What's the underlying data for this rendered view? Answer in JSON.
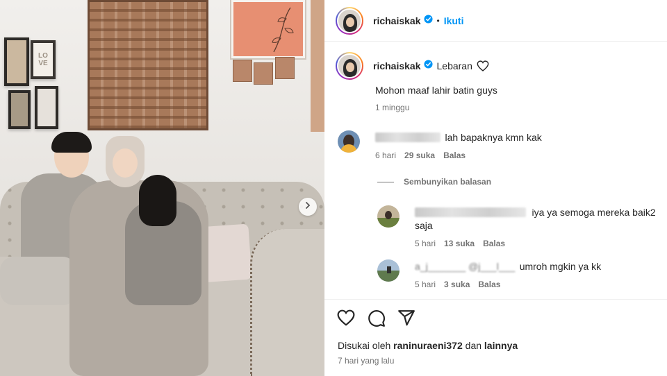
{
  "post": {
    "username": "richaiskak",
    "dot": "•",
    "follow_label": "Ikuti"
  },
  "caption": {
    "username": "richaiskak",
    "location_text": "Lebaran",
    "text": "Mohon maaf lahir batin guys",
    "time": "1 minggu"
  },
  "comments": [
    {
      "text": "lah bapaknya kmn kak",
      "time": "6 hari",
      "likes": "29 suka",
      "reply_label": "Balas",
      "hide_replies_label": "Sembunyikan balasan"
    }
  ],
  "replies": [
    {
      "text": "iya ya semoga mereka baik2",
      "text_line2": "saja",
      "time": "5 hari",
      "likes": "13 suka",
      "reply_label": "Balas"
    },
    {
      "text_prefix": "a_j_______  @j___l___",
      "text": "umroh mgkin ya kk",
      "time": "5 hari",
      "likes": "3 suka",
      "reply_label": "Balas"
    }
  ],
  "footer": {
    "liked_by_prefix": "Disukai oleh",
    "liked_by_user": "raninuraeni372",
    "liked_by_and": "dan",
    "liked_by_others": "lainnya",
    "time_ago": "7 hari yang lalu"
  },
  "icons": {
    "like": "heart-icon",
    "comment": "comment-icon",
    "share": "share-icon",
    "verified": "verified-badge-icon",
    "carousel_next": "chevron-right-icon"
  },
  "colors": {
    "link_blue": "#0095f6",
    "verified_blue": "#0095f6",
    "muted_text": "#737373"
  }
}
